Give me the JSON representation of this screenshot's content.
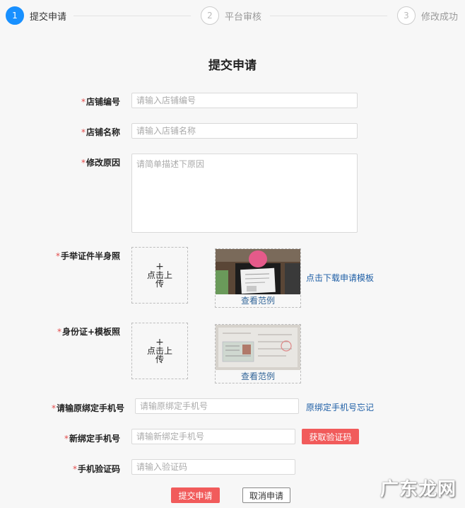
{
  "steps": [
    {
      "num": "1",
      "label": "提交申请"
    },
    {
      "num": "2",
      "label": "平台审核"
    },
    {
      "num": "3",
      "label": "修改成功"
    }
  ],
  "title": "提交申请",
  "required_mark": "*",
  "form": {
    "store_id": {
      "label": "店铺编号",
      "placeholder": "请输入店铺编号"
    },
    "store_name": {
      "label": "店铺名称",
      "placeholder": "请输入店铺名称"
    },
    "reason": {
      "label": "修改原因",
      "placeholder": "请简单描述下原因"
    },
    "half_photo": {
      "label": "手举证件半身照",
      "upload_text": "点击上传",
      "sample_caption": "查看范例"
    },
    "id_template": {
      "label": "身份证+模板照",
      "upload_text": "点击上传",
      "sample_caption": "查看范例"
    },
    "old_phone": {
      "label": "请输原绑定手机号",
      "placeholder": "请输原绑定手机号"
    },
    "new_phone": {
      "label": "新绑定手机号",
      "placeholder": "请输新绑定手机号"
    },
    "verify_code": {
      "label": "手机验证码",
      "placeholder": "请输入验证码"
    }
  },
  "links": {
    "download_template": "点击下载申请模板",
    "forgot_phone": "原绑定手机号忘记"
  },
  "buttons": {
    "get_code": "获取验证码",
    "submit": "提交申请",
    "cancel": "取消申请"
  },
  "watermark": "广东龙网",
  "colors": {
    "accent": "#1890ff",
    "danger": "#f15b5b",
    "link": "#1f5fa6"
  }
}
